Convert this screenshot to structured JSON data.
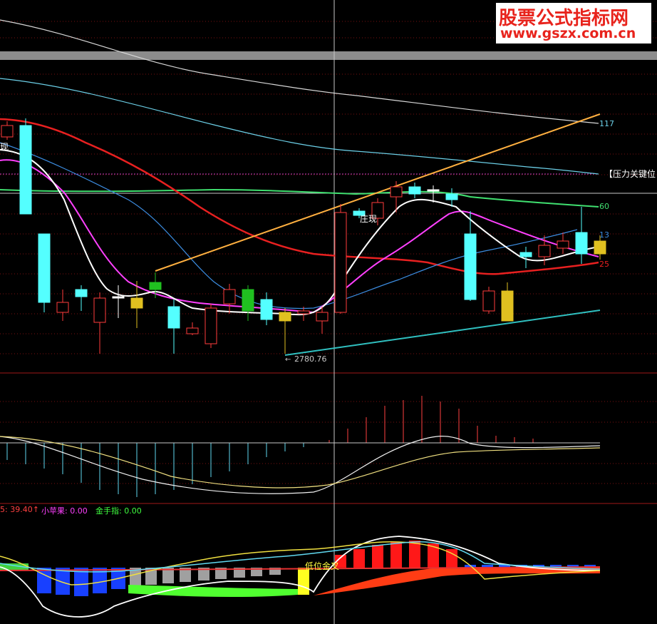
{
  "watermark": {
    "line1": "股票公式指标网",
    "line2": "www.gszx.com.cn"
  },
  "labels": {
    "pressure": "【压力关键位",
    "zhuangxian": "庄现",
    "zhuangxian_partial": "现",
    "low_value": "2780.76",
    "low_arrow": "←",
    "golden_cross": "低位金叉"
  },
  "right_axis": {
    "v117": "117",
    "v60": "60",
    "v13": "13",
    "v25": "25"
  },
  "indicator_row": {
    "first": "5: 39.40↑",
    "apple_label": "小苹果: 0.00",
    "gold_label": "金手指: 0.00"
  },
  "colors": {
    "up": "#ff3c3c",
    "down": "#54ffff",
    "ma5": "#ffffff",
    "ma10": "#ff3cff",
    "ma20": "#ff2020",
    "ma60": "#40e070",
    "ma117": "#6cd0e8",
    "long": "#e0e0e0"
  },
  "chart_data": [
    {
      "type": "candlestick",
      "title": "",
      "low_annotation": 2780.76,
      "candles": [
        {
          "o": 0,
          "c": 0,
          "dir": "up"
        },
        {
          "o": 0,
          "c": 0,
          "dir": "down"
        },
        {
          "o": 0,
          "c": 0,
          "dir": "down"
        },
        {
          "o": 0,
          "c": 0,
          "dir": "up"
        },
        {
          "o": 0,
          "c": 0,
          "dir": "down"
        },
        {
          "o": 0,
          "c": 0,
          "dir": "up"
        },
        {
          "o": 0,
          "c": 0,
          "dir": "doji"
        },
        {
          "o": 0,
          "c": 0,
          "dir": "up"
        },
        {
          "o": 0,
          "c": 0,
          "dir": "down"
        },
        {
          "o": 0,
          "c": 0,
          "dir": "down"
        },
        {
          "o": 0,
          "c": 0,
          "dir": "up"
        },
        {
          "o": 0,
          "c": 0,
          "dir": "up"
        },
        {
          "o": 0,
          "c": 0,
          "dir": "up"
        },
        {
          "o": 0,
          "c": 0,
          "dir": "down"
        },
        {
          "o": 0,
          "c": 0,
          "dir": "doji"
        },
        {
          "o": 0,
          "c": 0,
          "dir": "up"
        },
        {
          "o": 0,
          "c": 0,
          "dir": "down"
        },
        {
          "o": 0,
          "c": 0,
          "dir": "up"
        },
        {
          "o": 0,
          "c": 0,
          "dir": "up"
        },
        {
          "o": 0,
          "c": 0,
          "dir": "up"
        },
        {
          "o": 0,
          "c": 0,
          "dir": "up"
        },
        {
          "o": 0,
          "c": 0,
          "dir": "up"
        },
        {
          "o": 0,
          "c": 0,
          "dir": "down"
        },
        {
          "o": 0,
          "c": 0,
          "dir": "doji"
        },
        {
          "o": 0,
          "c": 0,
          "dir": "down"
        },
        {
          "o": 0,
          "c": 0,
          "dir": "down"
        },
        {
          "o": 0,
          "c": 0,
          "dir": "up"
        },
        {
          "o": 0,
          "c": 0,
          "dir": "doji"
        },
        {
          "o": 0,
          "c": 0,
          "dir": "down"
        },
        {
          "o": 0,
          "c": 0,
          "dir": "up"
        },
        {
          "o": 0,
          "c": 0,
          "dir": "down"
        },
        {
          "o": 0,
          "c": 0,
          "dir": "doji"
        }
      ],
      "ma_labels": [
        "117",
        "60",
        "13",
        "25"
      ]
    },
    {
      "type": "bar",
      "title": "",
      "series": [
        {
          "values": [
            -3,
            -4,
            -5,
            -6,
            -7,
            -7,
            -6,
            -5,
            -4,
            -3,
            -2,
            -1,
            -0.5,
            0,
            0.5,
            1,
            2,
            3,
            4,
            5,
            6,
            5,
            4,
            3,
            2,
            1,
            0.5,
            0.3,
            0.2
          ]
        }
      ]
    },
    {
      "type": "bar",
      "title": "",
      "series": [
        {
          "values": [
            0
          ]
        }
      ]
    }
  ]
}
